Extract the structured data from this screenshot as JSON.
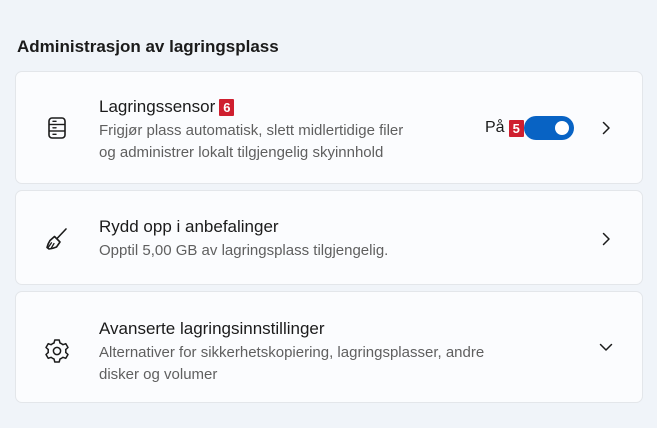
{
  "section": {
    "title": "Administrasjon av lagringsplass"
  },
  "items": [
    {
      "title": "Lagringssensor",
      "badge": "6",
      "description_line1": "Frigjør plass automatisk, slett midlertidige filer",
      "description_line2": "og administrer lokalt tilgjengelig skyinnhold",
      "icon": "hard-drive-icon",
      "toggle": {
        "state_label": "På",
        "badge": "5",
        "on": true,
        "accent_color": "#0863c4"
      },
      "action_icon": "chevron-right-icon"
    },
    {
      "title": "Rydd opp i anbefalinger",
      "description_line1": "Opptil 5,00 GB av lagringsplass tilgjengelig.",
      "icon": "broom-icon",
      "action_icon": "chevron-right-icon"
    },
    {
      "title": "Avanserte lagringsinnstillinger",
      "description_line1": "Alternativer for sikkerhetskopiering, lagringsplasser, andre",
      "description_line2": "disker og volumer",
      "icon": "gear-icon",
      "action_icon": "chevron-down-icon"
    }
  ],
  "colors": {
    "background": "#f0f4f9",
    "card": "#fbfcfe",
    "badge": "#cf1f2f"
  }
}
